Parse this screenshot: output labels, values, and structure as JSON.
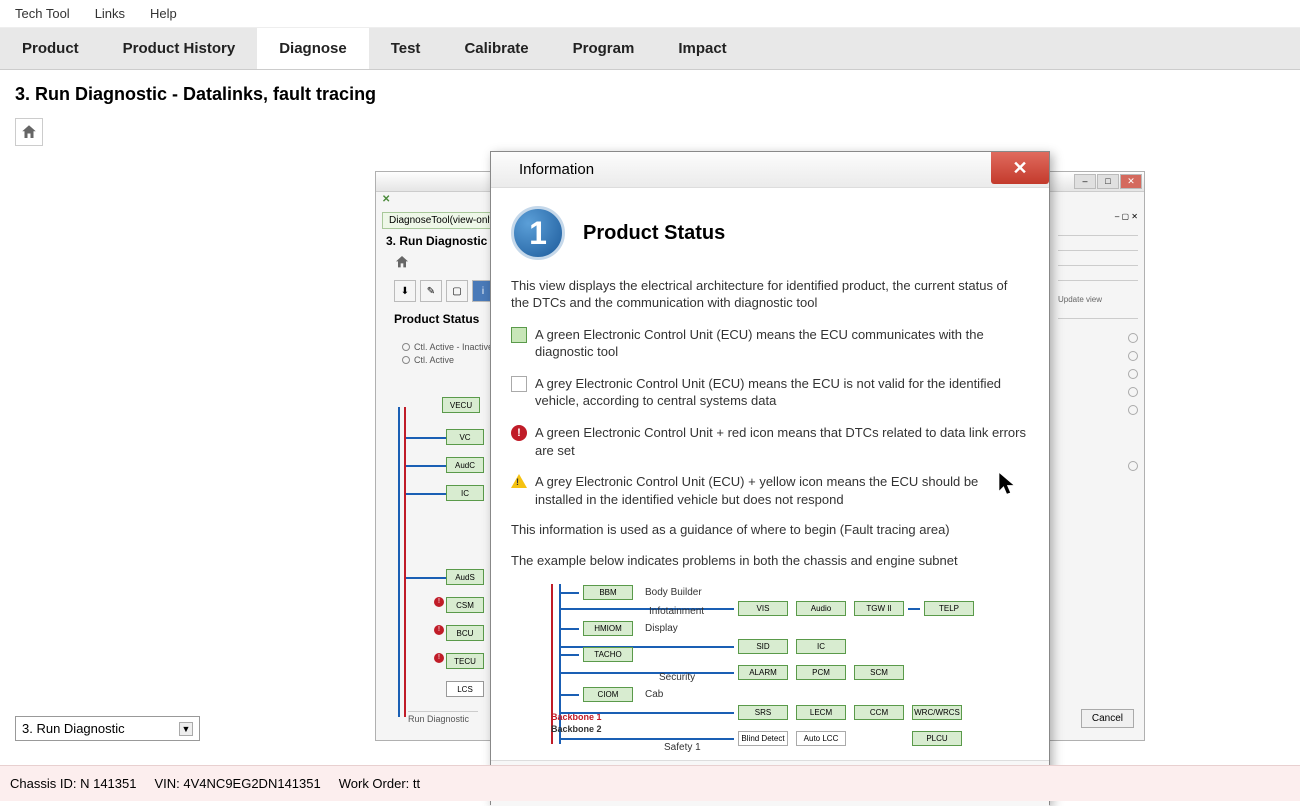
{
  "menubar": {
    "items": [
      "Tech Tool",
      "Links",
      "Help"
    ]
  },
  "tabs": [
    "Product",
    "Product History",
    "Diagnose",
    "Test",
    "Calibrate",
    "Program",
    "Impact"
  ],
  "active_tab_index": 2,
  "page_title": "3. Run Diagnostic - Datalinks, fault tracing",
  "bottom_select": "3. Run Diagnostic",
  "status_bar": {
    "chassis_id_label": "Chassis ID:",
    "chassis_id": "N 141351",
    "vin_label": "VIN:",
    "vin": "4V4NC9EG2DN141351",
    "work_order_label": "Work Order:",
    "work_order": "tt"
  },
  "bg_window": {
    "tab": "DiagnoseTool(view-only)",
    "heading": "3. Run Diagnostic -",
    "product_status": "Product Status",
    "radio1": "Ctl. Active - Inactive",
    "radio2": "Ctl. Active",
    "update_view": "Update view",
    "cancel": "Cancel",
    "bottom_tab": "Run Diagnostic",
    "ecus": [
      "VECU",
      "VC",
      "AudC",
      "IC",
      "AudS",
      "CSM",
      "BCU",
      "TECU",
      "LCS"
    ]
  },
  "dialog": {
    "title": "Information",
    "ps_title": "Product Status",
    "ps_number": "1",
    "intro": "This view displays the electrical architecture for identified product, the current status of the DTCs and the communication with diagnostic tool",
    "legend_green": "A green Electronic Control Unit (ECU) means the ECU communicates with the diagnostic tool",
    "legend_grey": "A grey Electronic Control Unit (ECU) means the ECU is not valid for the identified vehicle, according to central systems data",
    "legend_red": "A green Electronic Control Unit + red icon means that DTCs related to data link errors are set",
    "legend_yellow": "A grey Electronic Control Unit (ECU) + yellow icon means the ECU should be installed in the identified vehicle but does not respond",
    "guidance": "This information is used as a guidance of where to begin (Fault tracing area)",
    "example_intro": "The example below indicates problems in both the chassis and engine subnet",
    "diagram": {
      "row_labels": [
        "Body Builder",
        "Infotainment",
        "Display",
        "",
        "Security",
        "Cab",
        "",
        "",
        "Safety 1"
      ],
      "backbone1": "Backbone 1",
      "backbone2": "Backbone 2",
      "ecus_left": [
        "BBM",
        "HMIOM",
        "TACHO",
        "CIOM"
      ],
      "ecus_r1": [
        "VIS",
        "Audio",
        "TGW II",
        "TELP"
      ],
      "ecus_r2": [
        "SID",
        "IC"
      ],
      "ecus_r3": [
        "ALARM",
        "PCM",
        "SCM"
      ],
      "ecus_r4": [
        "SRS",
        "LECM",
        "CCM",
        "WRC/WRCS"
      ],
      "ecus_r5": [
        "Blind Detect",
        "Auto LCC",
        "",
        "PLCU"
      ]
    },
    "close_btn": "Close"
  }
}
